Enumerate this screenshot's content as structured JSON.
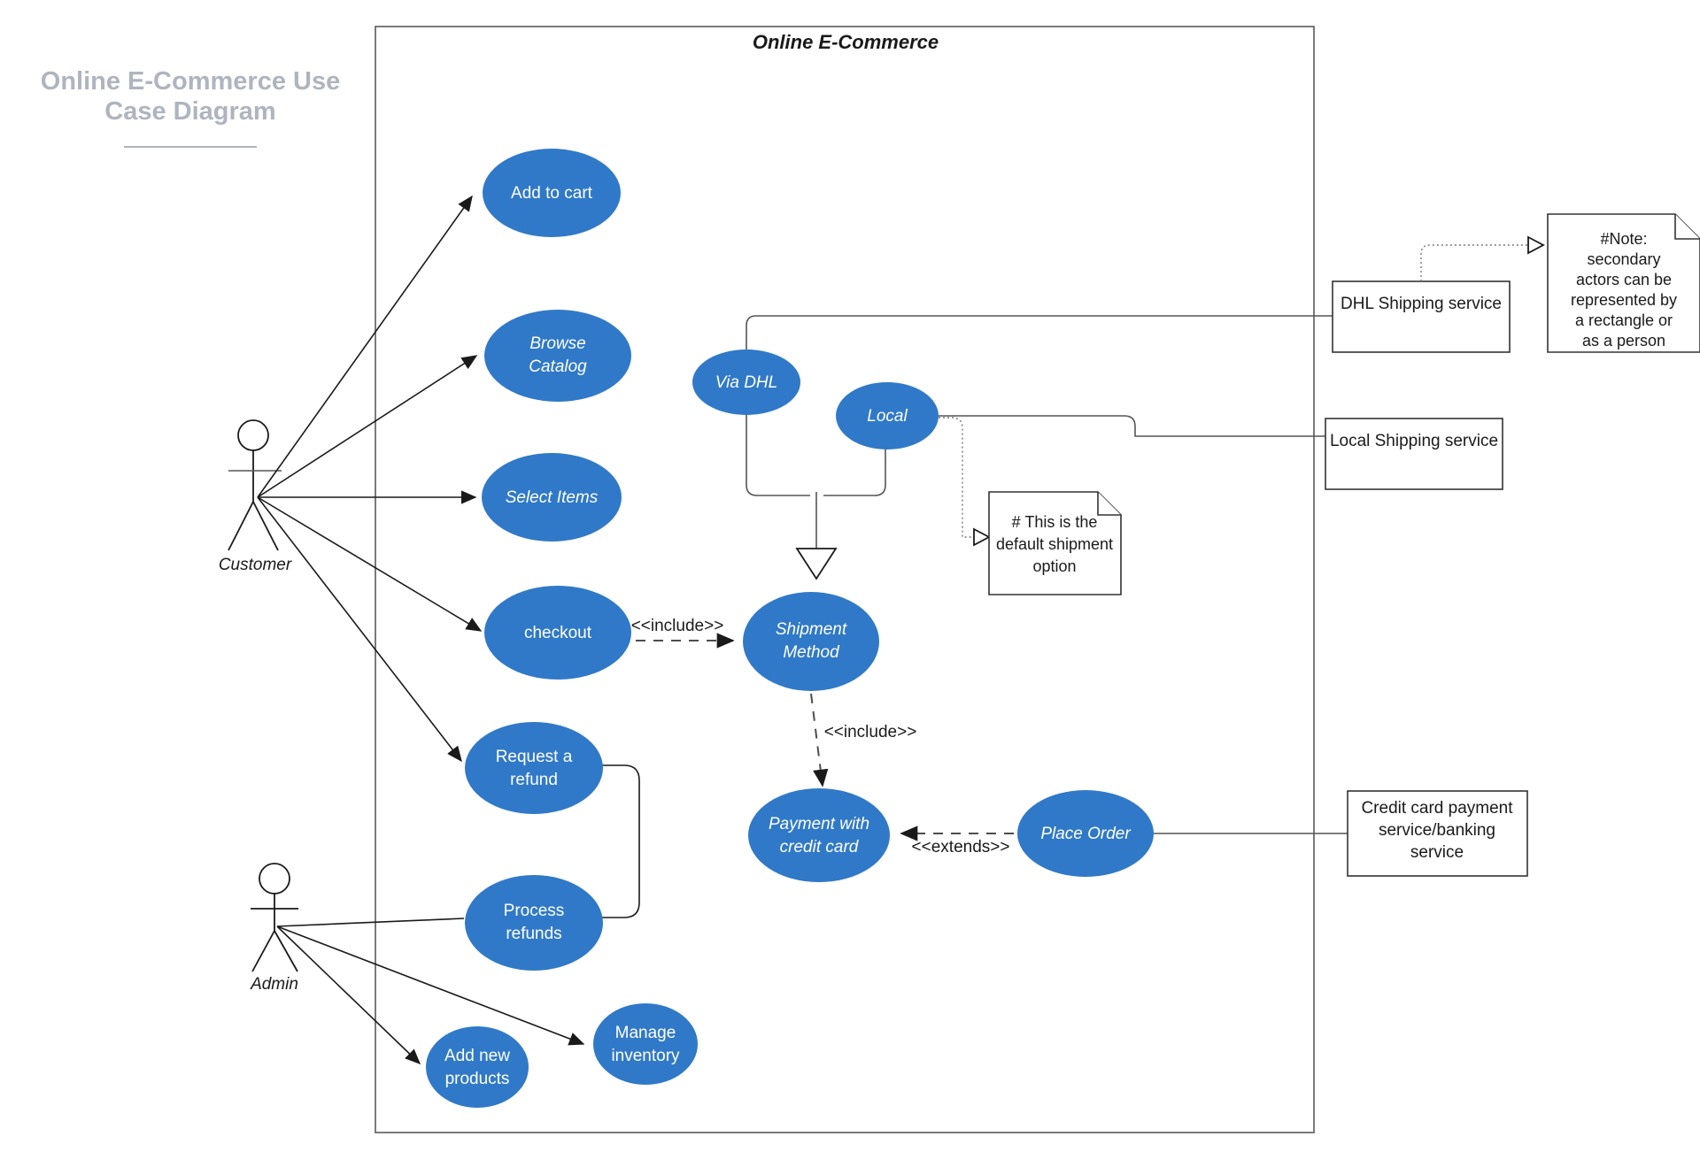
{
  "page": {
    "title": "Online E-Commerce Use Case Diagram",
    "system_title": "Online E-Commerce",
    "accent_color": "#3079c8",
    "title_color": "#aeb4c0",
    "line_color": "#1a1a1a"
  },
  "actors": [
    {
      "id": "customer",
      "label": "Customer",
      "icon": "stick-figure-icon"
    },
    {
      "id": "admin",
      "label": "Admin",
      "icon": "stick-figure-icon"
    }
  ],
  "use_cases": [
    {
      "id": "add-to-cart",
      "label": "Add to cart",
      "line1": "Add to cart",
      "line2": "",
      "italic": false
    },
    {
      "id": "browse-catalog",
      "label": "Browse Catalog",
      "line1": "Browse",
      "line2": "Catalog",
      "italic": true
    },
    {
      "id": "select-items",
      "label": "Select Items",
      "line1": "Select Items",
      "line2": "",
      "italic": true
    },
    {
      "id": "checkout",
      "label": "checkout",
      "line1": "checkout",
      "line2": "",
      "italic": false
    },
    {
      "id": "request-a-refund",
      "label": "Request a refund",
      "line1": "Request a",
      "line2": "refund",
      "italic": false
    },
    {
      "id": "process-refunds",
      "label": "Process refunds",
      "line1": "Process",
      "line2": "refunds",
      "italic": false
    },
    {
      "id": "add-new-products",
      "label": "Add new products",
      "line1": "Add new",
      "line2": "products",
      "italic": false
    },
    {
      "id": "manage-inventory",
      "label": "Manage inventory",
      "line1": "Manage",
      "line2": "inventory",
      "italic": false
    },
    {
      "id": "via-dhl",
      "label": "Via DHL",
      "line1": "Via DHL",
      "line2": "",
      "italic": true
    },
    {
      "id": "local",
      "label": "Local",
      "line1": "Local",
      "line2": "",
      "italic": true
    },
    {
      "id": "shipment-method",
      "label": "Shipment Method",
      "line1": "Shipment",
      "line2": "Method",
      "italic": true
    },
    {
      "id": "payment-with-credit-card",
      "label": "Payment with credit card",
      "line1": "Payment with",
      "line2": "credit card",
      "italic": true
    },
    {
      "id": "place-order",
      "label": "Place Order",
      "line1": "Place Order",
      "line2": "",
      "italic": true
    }
  ],
  "external_systems": [
    {
      "id": "dhl-shipping-service",
      "label": "DHL Shipping service",
      "lines": [
        "DHL Shipping service"
      ]
    },
    {
      "id": "local-shipping-service",
      "label": "Local Shipping service",
      "lines": [
        "Local Shipping service"
      ]
    },
    {
      "id": "credit-card-payment-service",
      "label": "Credit card payment service/banking service",
      "lines": [
        "Credit card payment",
        "service/banking",
        "service"
      ]
    }
  ],
  "notes": [
    {
      "id": "secondary-actors-note",
      "text": "#Note: secondary actors can be represented by a rectangle or as a person",
      "lines": [
        "#Note:",
        "secondary",
        "actors can be",
        "represented by",
        "a rectangle or",
        "as a person"
      ]
    },
    {
      "id": "default-shipment-note",
      "text": "# This is the default shipment option",
      "lines": [
        "# This is the",
        "default shipment",
        "option"
      ]
    }
  ],
  "relationships": [
    {
      "id": "rel-checkout-shipment",
      "type": "include",
      "label": "<<include>>",
      "from": "checkout",
      "to": "shipment-method"
    },
    {
      "id": "rel-shipment-payment",
      "type": "include",
      "label": "<<include>>",
      "from": "shipment-method",
      "to": "payment-with-credit-card"
    },
    {
      "id": "rel-placeorder-payment",
      "type": "extends",
      "label": "<<extends>>",
      "from": "place-order",
      "to": "payment-with-credit-card"
    }
  ],
  "stereotypes": {
    "include_1": "<<include>>",
    "include_2": "<<include>>",
    "extends_1": "<<extends>>"
  }
}
